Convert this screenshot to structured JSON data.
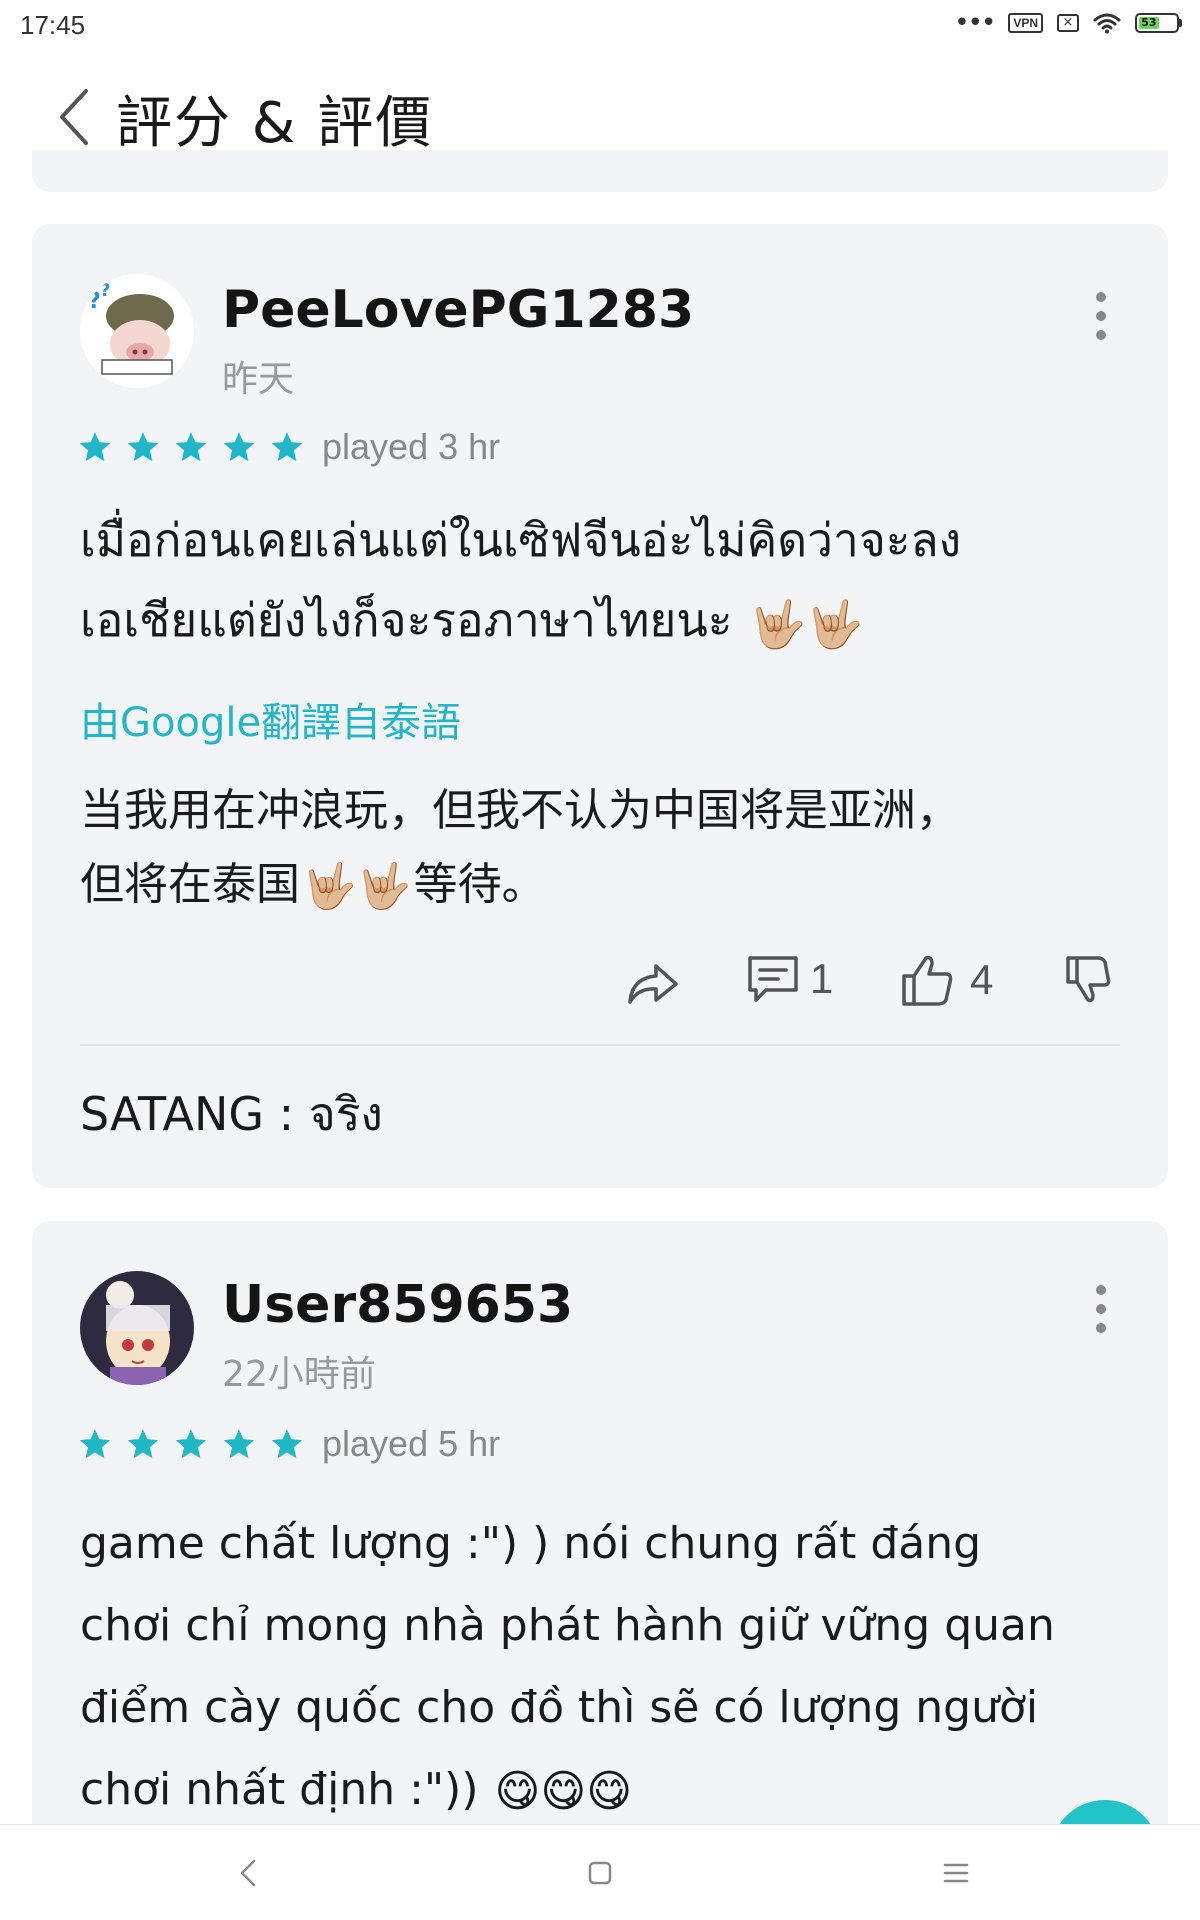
{
  "status_bar": {
    "time": "17:45",
    "vpn_label": "VPN",
    "battery_level": "53",
    "icons": [
      "more-dots-icon",
      "vpn-icon",
      "sim-off-icon",
      "wifi-icon",
      "battery-icon"
    ]
  },
  "header": {
    "title": "評分 & 評價",
    "back_icon": "chevron-left-icon"
  },
  "colors": {
    "accent": "#22b6c8",
    "star": "#1fb8c6",
    "card_bg": "#f3f4f6"
  },
  "reviews": [
    {
      "username": "PeeLovePG1283",
      "time_ago": "昨天",
      "stars": 5,
      "played": "played 3 hr",
      "text_line1": "เมื่อก่อนเคยเล่นแต่ในเซิฟจีนอ่ะไม่คิดว่าจะลง",
      "text_line2": "เอเชียแต่ยังไงก็จะรอภาษาไทยนะ",
      "text_emoji": "🤟🏼🤟🏼",
      "translate_label": "由Google翻譯自泰語",
      "translated_line1": "当我用在冲浪玩，但我不认为中国将是亚洲，",
      "translated_pre": "但将在泰国",
      "translated_emoji": "🤟🏼🤟🏼",
      "translated_post": "等待。",
      "actions": {
        "comments": "1",
        "likes": "4"
      },
      "reply": "SATANG : จริง"
    },
    {
      "username": "User859653",
      "time_ago": "22小時前",
      "stars": 5,
      "played": "played 5 hr",
      "text_line1": "game chất lượng :\") ) nói chung rất đáng",
      "text_line2": "chơi chỉ mong nhà phát hành giữ vững quan",
      "text_line3": "điểm cày quốc cho đồ thì sẽ có lượng người",
      "text_line4": "chơi nhất định :\"))",
      "text_emoji": "😋😋😋"
    }
  ]
}
